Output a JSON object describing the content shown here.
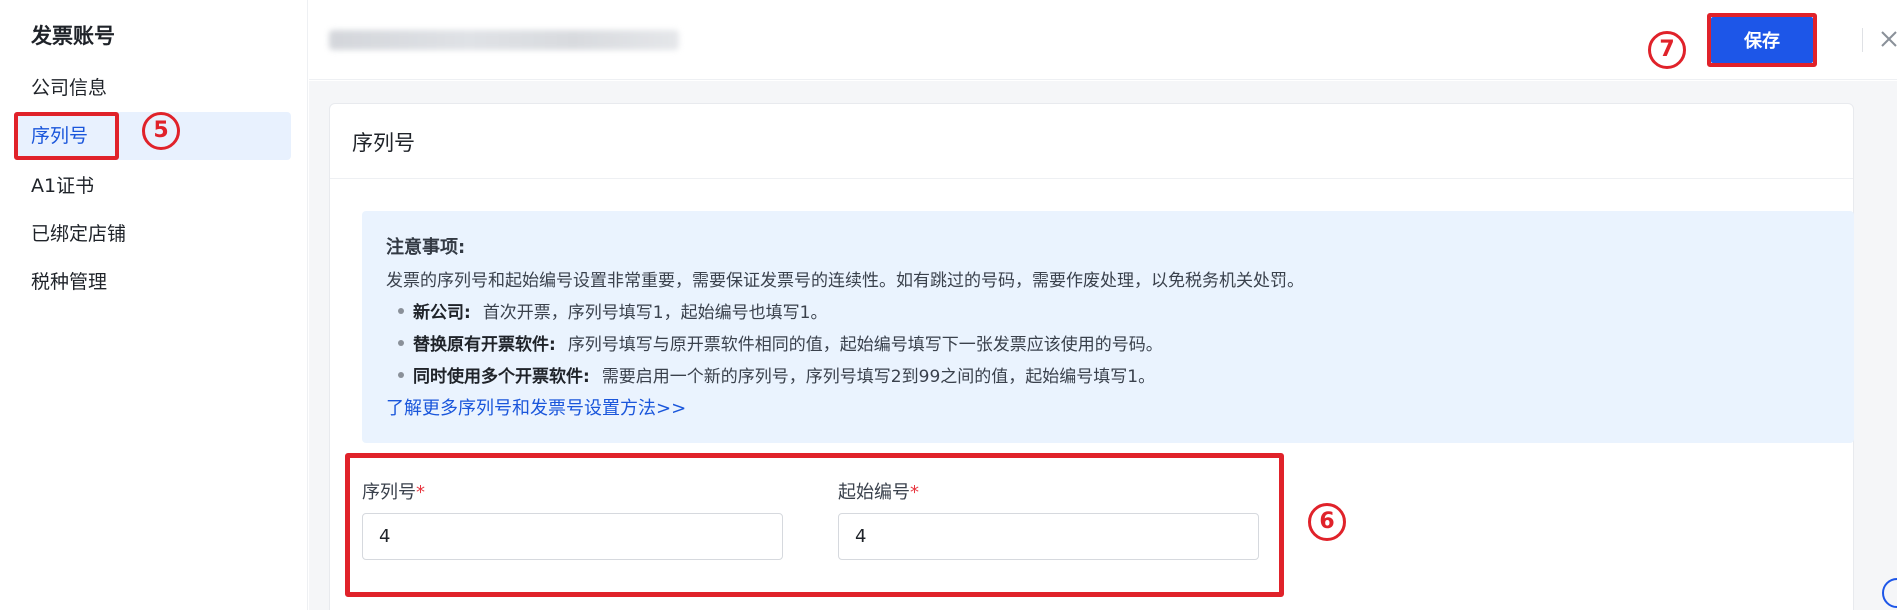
{
  "sidebar": {
    "title": "发票账号",
    "items": [
      {
        "label": "公司信息"
      },
      {
        "label": "序列号"
      },
      {
        "label": "A1证书"
      },
      {
        "label": "已绑定店铺"
      },
      {
        "label": "税种管理"
      }
    ]
  },
  "header": {
    "save_label": "保存"
  },
  "card": {
    "title": "序列号"
  },
  "notice": {
    "title": "注意事项:",
    "intro": "发票的序列号和起始编号设置非常重要，需要保证发票号的连续性。如有跳过的号码，需要作废处理，以免税务机关处罚。",
    "bullets": [
      {
        "term": "新公司:",
        "text": "首次开票，序列号填写1，起始编号也填写1。"
      },
      {
        "term": "替换原有开票软件:",
        "text": "序列号填写与原开票软件相同的值，起始编号填写下一张发票应该使用的号码。"
      },
      {
        "term": "同时使用多个开票软件:",
        "text": "需要启用一个新的序列号，序列号填写2到99之间的值，起始编号填写1。"
      }
    ],
    "link": "了解更多序列号和发票号设置方法>>"
  },
  "form": {
    "serial_label": "序列号",
    "serial_value": "4",
    "start_label": "起始编号",
    "start_value": "4",
    "required_mark": "*"
  },
  "steps": {
    "nav": "5",
    "form": "6",
    "save": "7"
  },
  "colors": {
    "accent": "#1d56e8",
    "highlight": "#e0222a",
    "active_bg": "#e8f1fe",
    "notice_bg": "#eaf3fe"
  },
  "icons": {
    "close": "close-icon",
    "help": "headset-help-icon"
  }
}
